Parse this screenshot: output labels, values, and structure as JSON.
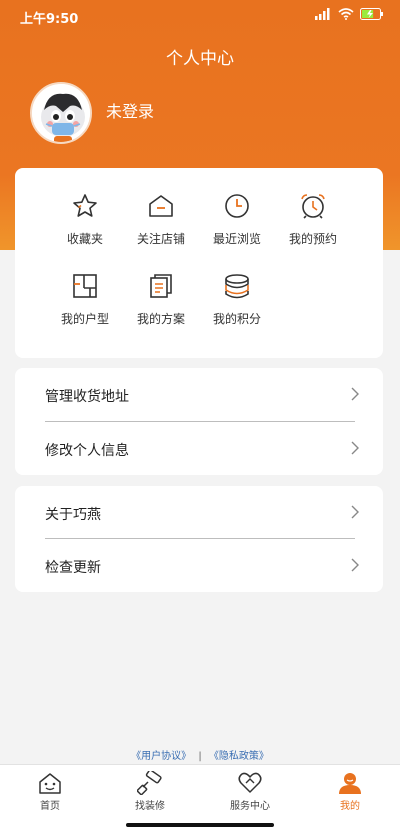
{
  "status": {
    "time": "上午9:50",
    "battery_level": 0.65
  },
  "header": {
    "title": "个人中心",
    "login_text": "未登录"
  },
  "grid": [
    {
      "label": "收藏夹",
      "icon": "star-icon"
    },
    {
      "label": "关注店铺",
      "icon": "store-icon"
    },
    {
      "label": "最近浏览",
      "icon": "clock-icon"
    },
    {
      "label": "我的预约",
      "icon": "alarm-clock-icon"
    },
    {
      "label": "我的户型",
      "icon": "floor-plan-icon"
    },
    {
      "label": "我的方案",
      "icon": "document-icon"
    },
    {
      "label": "我的积分",
      "icon": "coins-icon"
    }
  ],
  "menu1": [
    {
      "label": "管理收货地址"
    },
    {
      "label": "修改个人信息"
    }
  ],
  "menu2": [
    {
      "label": "关于巧燕"
    },
    {
      "label": "检查更新"
    }
  ],
  "footer": {
    "user_agreement": "《用户协议》",
    "separator": "|",
    "privacy_policy": "《隐私政策》"
  },
  "tabs": [
    {
      "label": "首页",
      "icon": "home-icon"
    },
    {
      "label": "找装修",
      "icon": "paint-roller-icon"
    },
    {
      "label": "服务中心",
      "icon": "heart-hand-icon"
    },
    {
      "label": "我的",
      "icon": "user-icon",
      "active": true
    }
  ],
  "colors": {
    "brand": "#e8721f",
    "link": "#3b6fb3"
  }
}
